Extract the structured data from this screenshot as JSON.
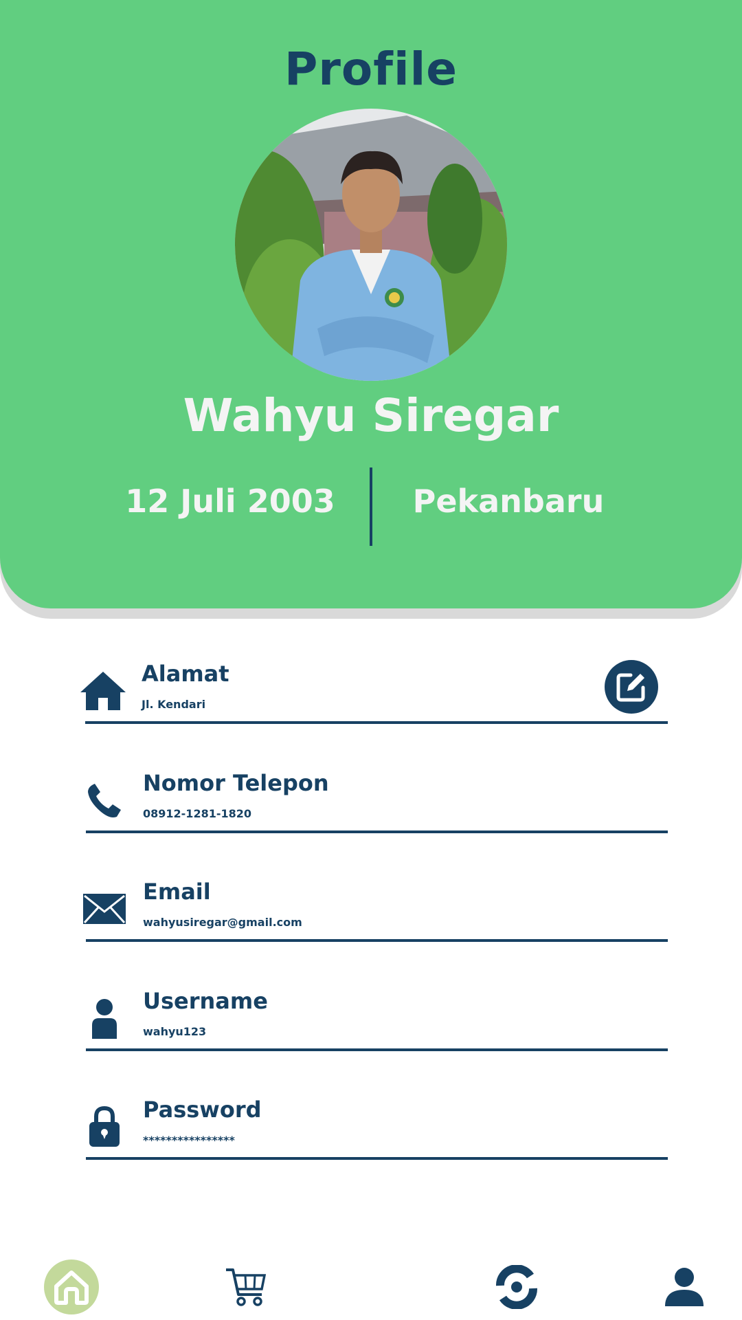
{
  "header": {
    "title": "Profile",
    "name": "Wahyu Siregar",
    "birth_date": "12 Juli 2003",
    "city": "Pekanbaru"
  },
  "fields": [
    {
      "label": "Alamat",
      "value": "Jl. Kendari",
      "icon": "home-icon"
    },
    {
      "label": "Nomor Telepon",
      "value": "08912-1281-1820",
      "icon": "phone-icon"
    },
    {
      "label": "Email",
      "value": "wahyusiregar@gmail.com",
      "icon": "envelope-icon"
    },
    {
      "label": "Username",
      "value": "wahyu123",
      "icon": "user-icon"
    },
    {
      "label": "Password",
      "value": "****************",
      "icon": "lock-icon"
    }
  ],
  "edit_button": {
    "icon": "edit-icon"
  },
  "bottom_nav": [
    {
      "icon": "home-icon",
      "active": true
    },
    {
      "icon": "cart-icon",
      "active": false
    },
    {
      "icon": "sync-icon",
      "active": false
    },
    {
      "icon": "profile-icon",
      "active": false
    }
  ],
  "colors": {
    "header_green": "#61ce80",
    "navy": "#174163",
    "active_nav_bg": "#c3d99b",
    "light_text": "#f4f4f4"
  }
}
